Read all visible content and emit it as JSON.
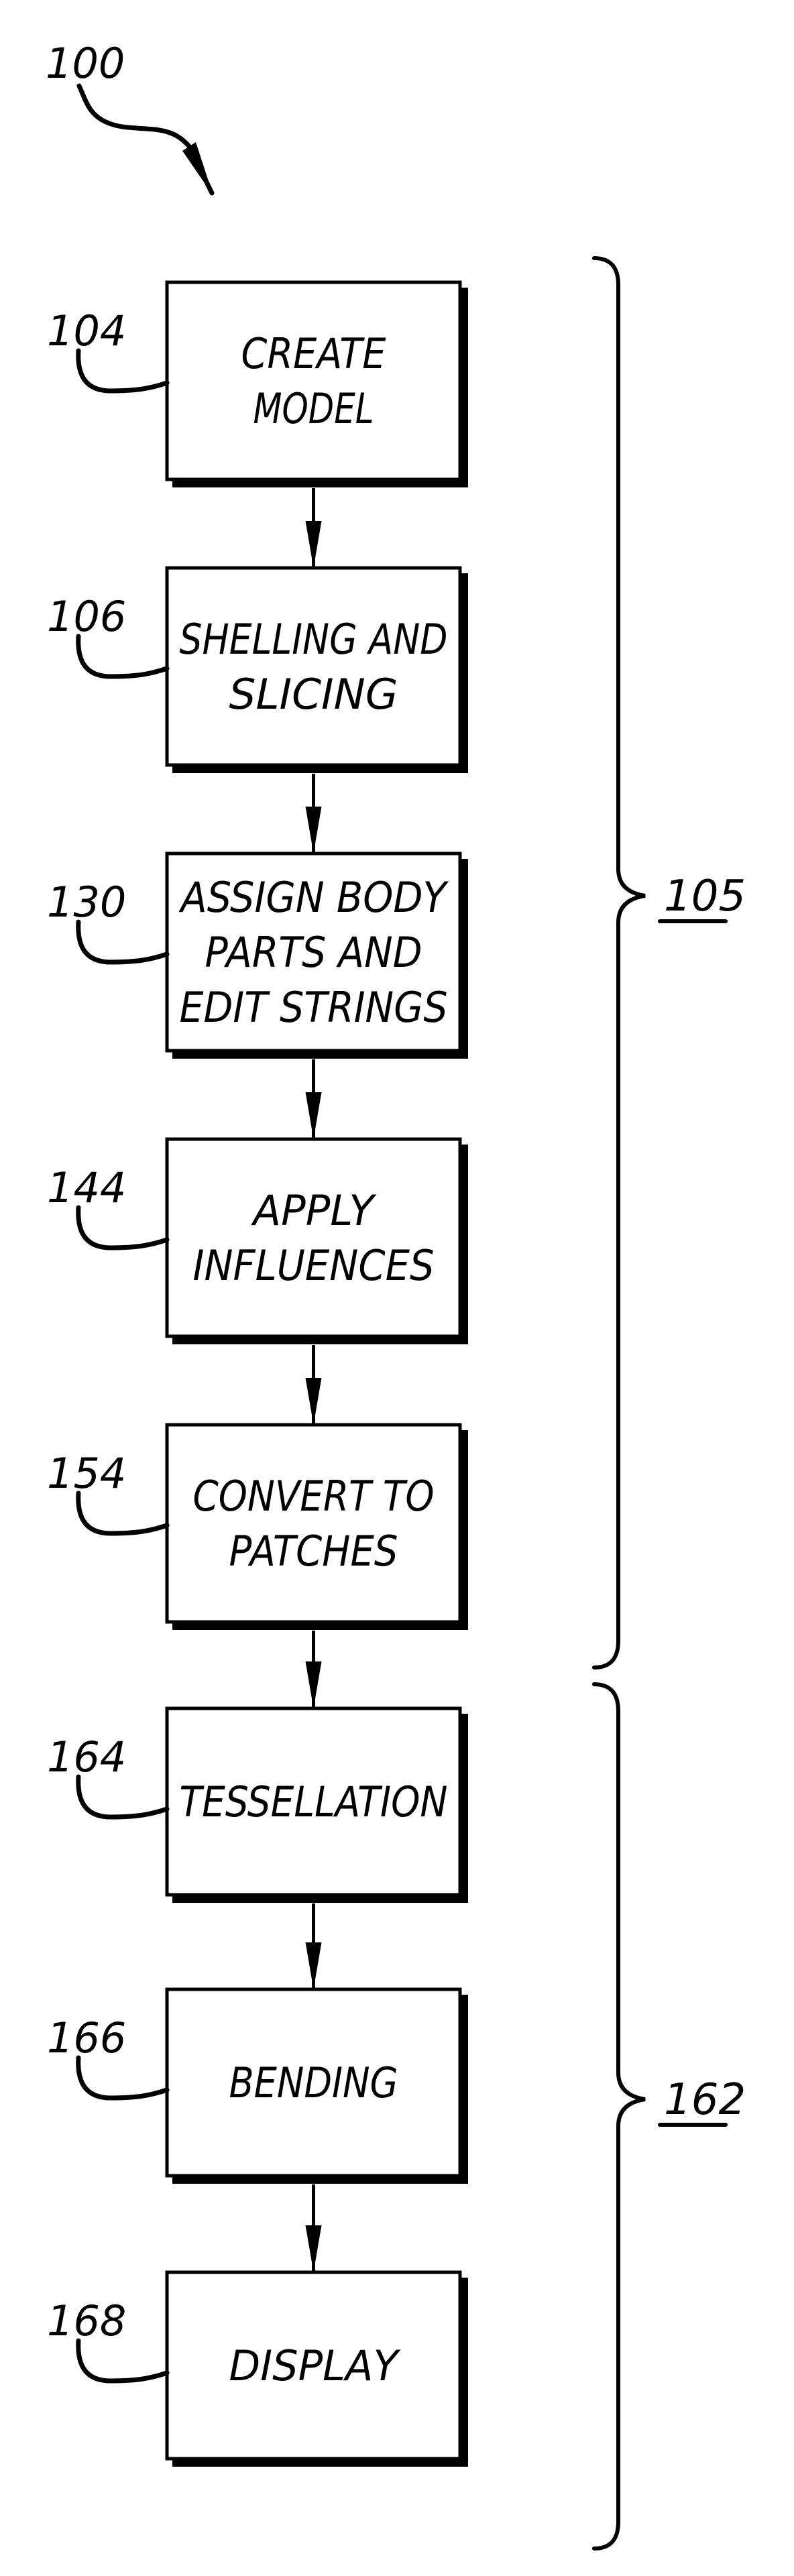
{
  "figure": {
    "reference": "100"
  },
  "steps": [
    {
      "ref": "104",
      "lines": [
        "CREATE",
        "MODEL"
      ]
    },
    {
      "ref": "106",
      "lines": [
        "SHELLING AND",
        "SLICING"
      ]
    },
    {
      "ref": "130",
      "lines": [
        "ASSIGN BODY",
        "PARTS AND",
        "EDIT STRINGS"
      ]
    },
    {
      "ref": "144",
      "lines": [
        "APPLY",
        "INFLUENCES"
      ]
    },
    {
      "ref": "154",
      "lines": [
        "CONVERT TO",
        "PATCHES"
      ]
    },
    {
      "ref": "164",
      "lines": [
        "TESSELLATION"
      ]
    },
    {
      "ref": "166",
      "lines": [
        "BENDING"
      ]
    },
    {
      "ref": "168",
      "lines": [
        "DISPLAY"
      ]
    }
  ],
  "groups": [
    {
      "ref": "105",
      "first_step": 0,
      "last_step": 4
    },
    {
      "ref": "162",
      "first_step": 5,
      "last_step": 7
    }
  ],
  "colors": {
    "ink": "#000000",
    "paper": "#ffffff"
  }
}
